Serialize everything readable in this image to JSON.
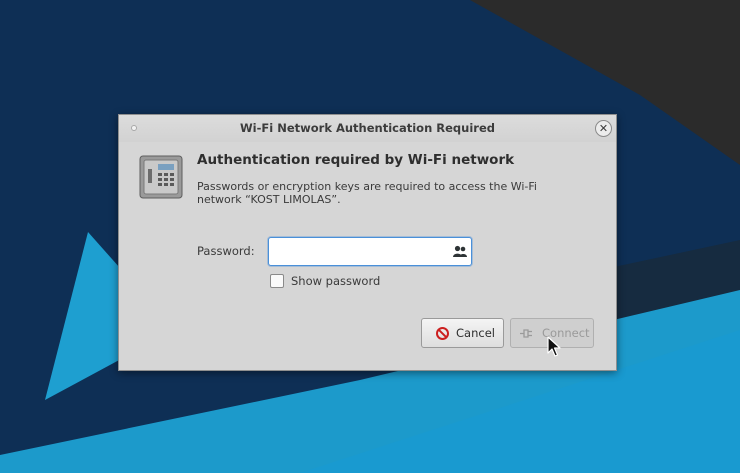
{
  "dialog": {
    "title": "Wi-Fi Network Authentication Required",
    "heading": "Authentication required by Wi-Fi network",
    "description": "Passwords or encryption keys are required to access the Wi-Fi network “KOST LIMOLAS”.",
    "password_label": "Password:",
    "password_value": "",
    "show_password_label": "Show password",
    "show_password_checked": false,
    "cancel_label": "Cancel",
    "connect_label": "Connect",
    "connect_enabled": false,
    "icons": {
      "close": "close-icon",
      "dialog": "safe-icon",
      "password_field": "users-icon",
      "cancel": "stop-icon",
      "connect": "plug-icon"
    }
  },
  "colors": {
    "desktop_navy": "#0d2b4e",
    "desktop_blue": "#1e9fd0",
    "desktop_dark": "#2a2a2a",
    "dialog_bg": "#d6d6d6",
    "focus_accent": "#4a90d9",
    "cancel_red": "#cc1f1f"
  }
}
